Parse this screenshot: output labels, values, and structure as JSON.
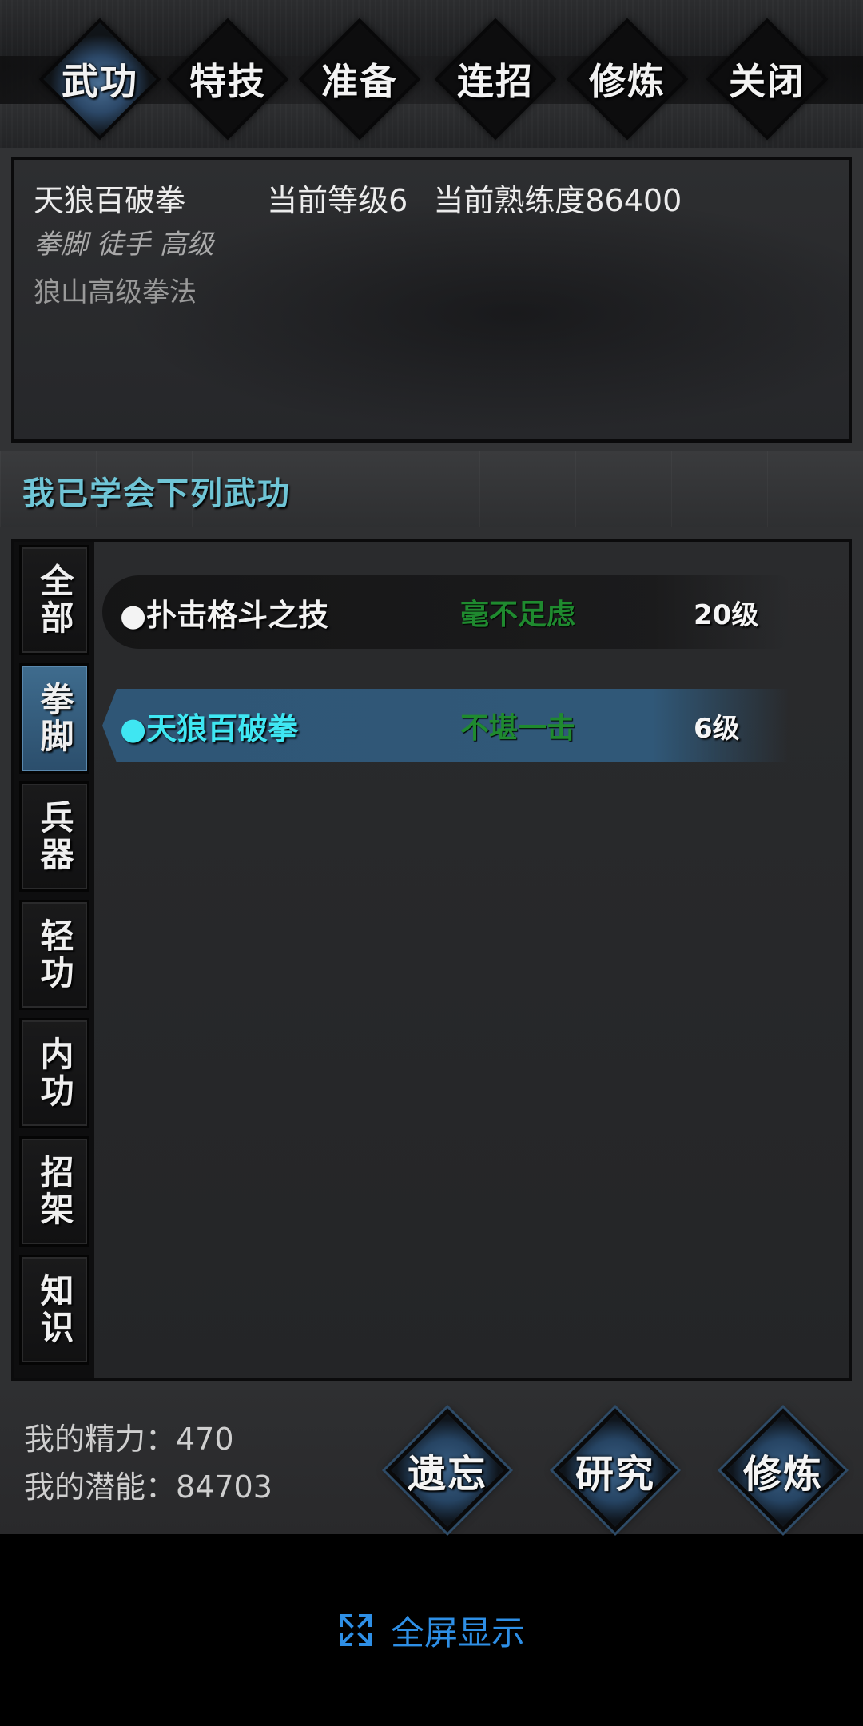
{
  "tabs": [
    {
      "label": "武功",
      "active": true
    },
    {
      "label": "特技",
      "active": false
    },
    {
      "label": "准备",
      "active": false
    },
    {
      "label": "连招",
      "active": false
    },
    {
      "label": "修炼",
      "active": false
    },
    {
      "label": "关闭",
      "active": false
    }
  ],
  "info": {
    "skill_name": "天狼百破拳",
    "current_level": "当前等级6",
    "current_proficiency": "当前熟练度86400",
    "tags": "拳脚 徒手 高级",
    "description": "狼山高级拳法"
  },
  "section_title": "我已学会下列武功",
  "categories": [
    {
      "label": "全部",
      "active": false
    },
    {
      "label": "拳脚",
      "active": true
    },
    {
      "label": "兵器",
      "active": false
    },
    {
      "label": "轻功",
      "active": false
    },
    {
      "label": "内功",
      "active": false
    },
    {
      "label": "招架",
      "active": false
    },
    {
      "label": "知识",
      "active": false
    }
  ],
  "skills": [
    {
      "name": "●扑击格斗之技",
      "rank": "毫不足虑",
      "level": "20级",
      "selected": false
    },
    {
      "name": "●天狼百破拳",
      "rank": "不堪一击",
      "level": "6级",
      "selected": true
    }
  ],
  "stats": {
    "energy": "我的精力：470",
    "potential": "我的潜能：84703"
  },
  "actions": [
    {
      "label": "遗忘"
    },
    {
      "label": "研究"
    },
    {
      "label": "修炼"
    }
  ],
  "fullscreen": {
    "label": "全屏显示",
    "icon": "expand-icon"
  },
  "colors": {
    "accent_cyan": "#3fe6f2",
    "section_title": "#6fc5d6",
    "rank_green": "#1f8a2f",
    "selected_row": "#305878",
    "fullscreen_blue": "#2e8fe6"
  }
}
